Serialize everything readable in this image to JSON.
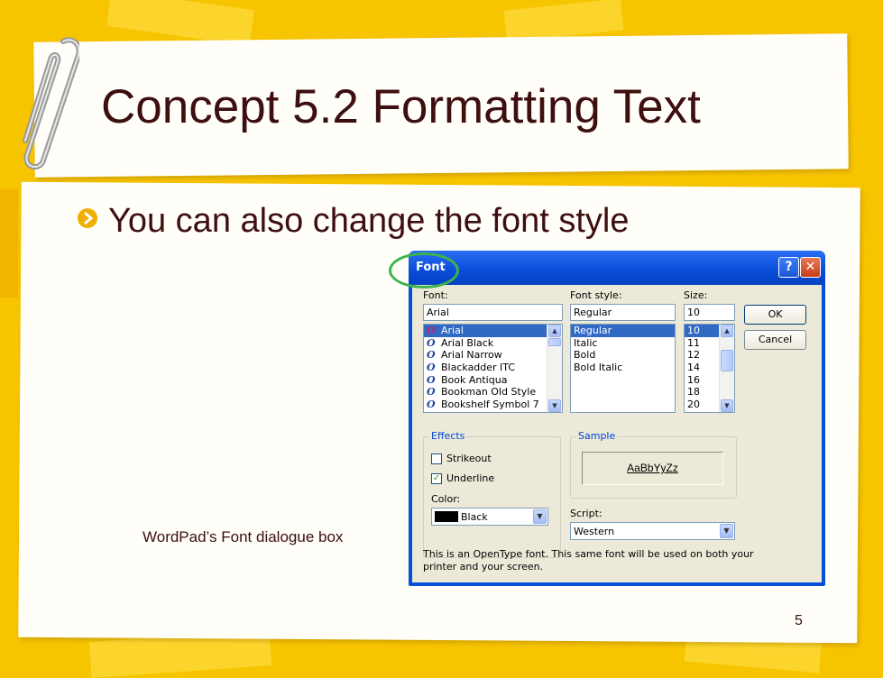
{
  "slide": {
    "title": "Concept 5.2 Formatting Text",
    "bullet": "You can also change the font style",
    "caption": "WordPad’s Font dialogue box",
    "page_number": "5"
  },
  "dialog": {
    "title": "Font",
    "help_button": "?",
    "close_button": "✕",
    "font_label": "Font:",
    "font_value": "Arial",
    "font_list": [
      "Arial",
      "Arial Black",
      "Arial Narrow",
      "Blackadder ITC",
      "Book Antiqua",
      "Bookman Old Style",
      "Bookshelf Symbol 7"
    ],
    "font_list_selected": 0,
    "style_label": "Font style:",
    "style_value": "Regular",
    "style_list": [
      "Regular",
      "Italic",
      "Bold",
      "Bold Italic"
    ],
    "size_label": "Size:",
    "size_value": "10",
    "size_list": [
      "10",
      "11",
      "12",
      "14",
      "16",
      "18",
      "20"
    ],
    "ok_label": "OK",
    "cancel_label": "Cancel",
    "effects_label": "Effects",
    "strikeout_label": "Strikeout",
    "strikeout_checked": false,
    "underline_label": "Underline",
    "underline_checked": true,
    "color_label": "Color:",
    "color_value": "Black",
    "sample_label": "Sample",
    "sample_text": "AaBbYyZz",
    "script_label": "Script:",
    "script_value": "Western",
    "description_line1": "This is an OpenType font. This same font will be used on both your",
    "description_line2": "printer and your screen."
  },
  "icons": {
    "bullet": "circle-arrow-icon",
    "font_type": "opentype-font-icon",
    "paperclip": "paperclip-icon"
  },
  "colors": {
    "background": "#f7c400",
    "title_text": "#3d0f0f",
    "bullet": "#f0b000",
    "highlight_ring": "#3cb44b",
    "dialog_titlebar": "#0a4bd9",
    "selection": "#316ac5"
  }
}
